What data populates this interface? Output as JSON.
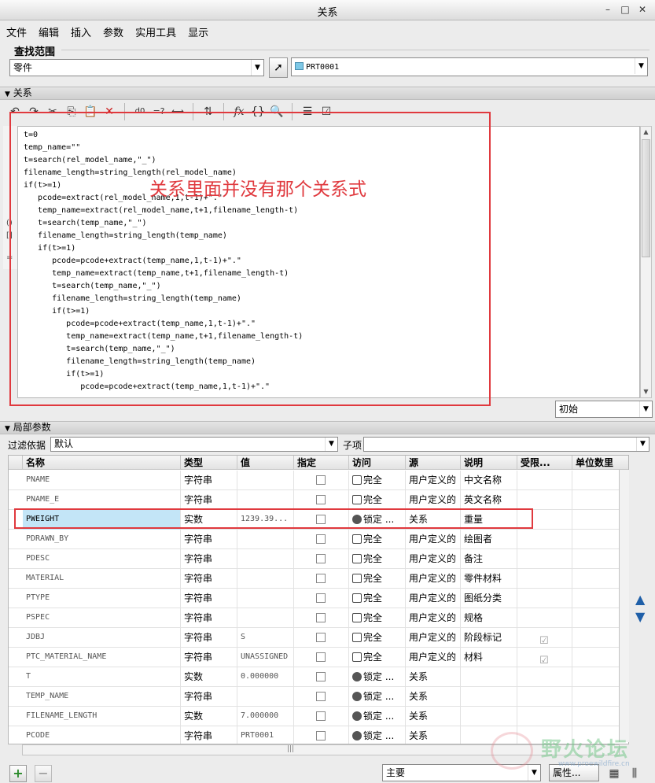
{
  "window": {
    "title": "关系",
    "controls": [
      "–",
      "□",
      "✕"
    ]
  },
  "menu": [
    "文件",
    "编辑",
    "插入",
    "参数",
    "实用工具",
    "显示"
  ],
  "scope": {
    "label": "查找范围",
    "type_value": "零件",
    "model_value": "PRT0001"
  },
  "relations": {
    "header": "关系",
    "lines": [
      "t=0",
      "temp_name=\"\"",
      "t=search(rel_model_name,\"_\")",
      "filename_length=string_length(rel_model_name)",
      "if(t>=1)",
      "   pcode=extract(rel_model_name,1,t-1)+\".\"",
      "   temp_name=extract(rel_model_name,t+1,filename_length-t)",
      "   t=search(temp_name,\"_\")",
      "   filename_length=string_length(temp_name)",
      "   if(t>=1)",
      "      pcode=pcode+extract(temp_name,1,t-1)+\".\"",
      "      temp_name=extract(temp_name,t+1,filename_length-t)",
      "      t=search(temp_name,\"_\")",
      "      filename_length=string_length(temp_name)",
      "      if(t>=1)",
      "         pcode=pcode+extract(temp_name,1,t-1)+\".\"",
      "         temp_name=extract(temp_name,t+1,filename_length-t)",
      "         t=search(temp_name,\"_\")",
      "         filename_length=string_length(temp_name)",
      "         if(t>=1)",
      "            pcode=pcode+extract(temp_name,1,t-1)+\".\""
    ],
    "annotation": "关系里面并没有那个关系式",
    "initial_select": "初始"
  },
  "local_params": {
    "header": "局部参数",
    "filter_label": "过滤依据",
    "filter_value": "默认",
    "subitem_label": "子项",
    "columns": [
      "名称",
      "类型",
      "值",
      "指定",
      "访问",
      "源",
      "说明",
      "受限...",
      "单位数里"
    ],
    "rows": [
      {
        "name": "PNAME",
        "type": "字符串",
        "value": "",
        "access": "完全",
        "access_icon": "unlock",
        "source": "用户定义的",
        "desc": "中文名称",
        "restricted": false
      },
      {
        "name": "PNAME_E",
        "type": "字符串",
        "value": "",
        "access": "完全",
        "access_icon": "unlock",
        "source": "用户定义的",
        "desc": "英文名称",
        "restricted": false
      },
      {
        "name": "PWEIGHT",
        "type": "实数",
        "value": "1239.39...",
        "access": "锁定 ...",
        "access_icon": "lock",
        "source": "关系",
        "desc": "重量",
        "restricted": false
      },
      {
        "name": "PDRAWN_BY",
        "type": "字符串",
        "value": "",
        "access": "完全",
        "access_icon": "unlock",
        "source": "用户定义的",
        "desc": "绘图者",
        "restricted": false
      },
      {
        "name": "PDESC",
        "type": "字符串",
        "value": "",
        "access": "完全",
        "access_icon": "unlock",
        "source": "用户定义的",
        "desc": "备注",
        "restricted": false
      },
      {
        "name": "MATERIAL",
        "type": "字符串",
        "value": "",
        "access": "完全",
        "access_icon": "unlock",
        "source": "用户定义的",
        "desc": "零件材料",
        "restricted": false
      },
      {
        "name": "PTYPE",
        "type": "字符串",
        "value": "",
        "access": "完全",
        "access_icon": "unlock",
        "source": "用户定义的",
        "desc": "图纸分类",
        "restricted": false
      },
      {
        "name": "PSPEC",
        "type": "字符串",
        "value": "",
        "access": "完全",
        "access_icon": "unlock",
        "source": "用户定义的",
        "desc": "规格",
        "restricted": false
      },
      {
        "name": "JDBJ",
        "type": "字符串",
        "value": "S",
        "access": "完全",
        "access_icon": "unlock",
        "source": "用户定义的",
        "desc": "阶段标记",
        "restricted": true
      },
      {
        "name": "PTC_MATERIAL_NAME",
        "type": "字符串",
        "value": "UNASSIGNED",
        "access": "完全",
        "access_icon": "unlock",
        "source": "用户定义的",
        "desc": "材料",
        "restricted": true
      },
      {
        "name": "T",
        "type": "实数",
        "value": "0.000000",
        "access": "锁定 ...",
        "access_icon": "lock",
        "source": "关系",
        "desc": "",
        "restricted": false
      },
      {
        "name": "TEMP_NAME",
        "type": "字符串",
        "value": "",
        "access": "锁定 ...",
        "access_icon": "lock",
        "source": "关系",
        "desc": "",
        "restricted": false
      },
      {
        "name": "FILENAME_LENGTH",
        "type": "实数",
        "value": "7.000000",
        "access": "锁定 ...",
        "access_icon": "lock",
        "source": "关系",
        "desc": "",
        "restricted": false
      },
      {
        "name": "PCODE",
        "type": "字符串",
        "value": "PRT0001",
        "access": "锁定 ...",
        "access_icon": "lock",
        "source": "关系",
        "desc": "",
        "restricted": false
      }
    ],
    "selected_row": 2,
    "bottom_combo": "主要",
    "properties_button": "属性..."
  },
  "watermark": {
    "title": "野火论坛",
    "url": "www.proewildfire.cn"
  },
  "colors": {
    "annotation": "#e0393e",
    "selection": "#c3e5f7"
  }
}
